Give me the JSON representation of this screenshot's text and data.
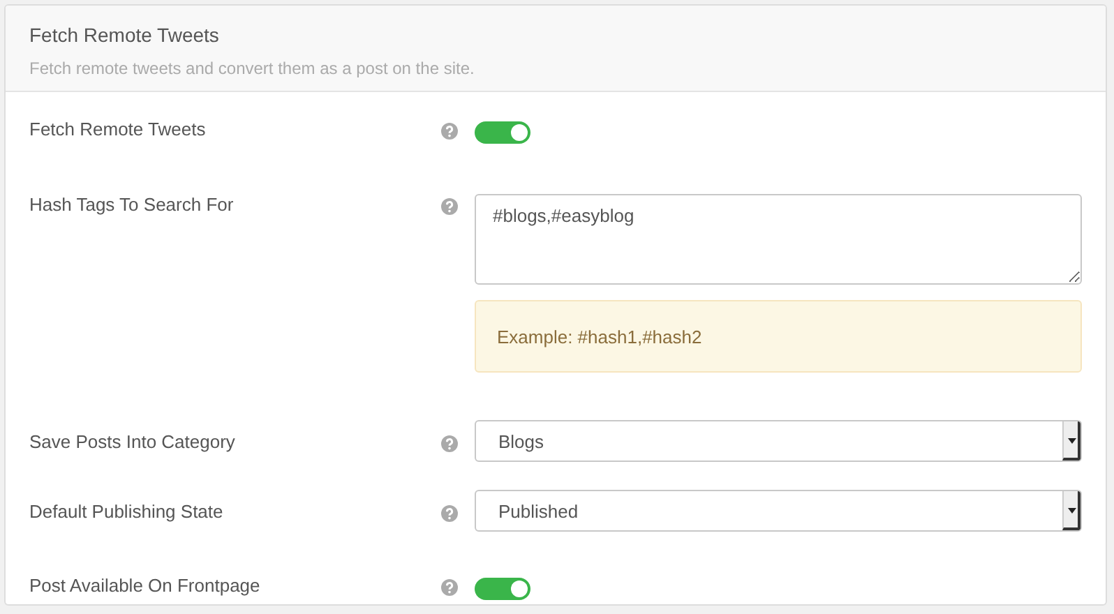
{
  "panel": {
    "title": "Fetch Remote Tweets",
    "description": "Fetch remote tweets and convert them as a post on the site."
  },
  "fields": [
    {
      "kind": "toggle",
      "label": "Fetch Remote Tweets",
      "on": true
    },
    {
      "kind": "textarea",
      "label": "Hash Tags To Search For",
      "value": "#blogs,#easyblog",
      "note": "Example: #hash1,#hash2"
    },
    {
      "kind": "select",
      "label": "Save Posts Into Category",
      "value": "Blogs"
    },
    {
      "kind": "select",
      "label": "Default Publishing State",
      "value": "Published"
    },
    {
      "kind": "toggle",
      "label": "Post Available On Frontpage",
      "on": true
    }
  ]
}
